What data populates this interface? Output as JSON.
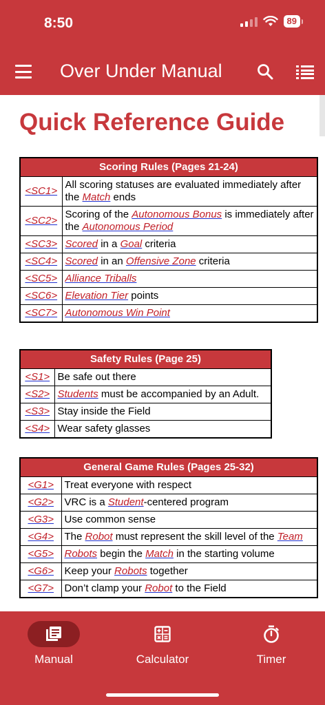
{
  "status": {
    "time": "8:50",
    "battery": "89"
  },
  "appbar": {
    "title": "Over Under Manual"
  },
  "page": {
    "title": "Quick Reference Guide"
  },
  "scoring": {
    "header": "Scoring Rules (Pages 21-24)",
    "rows": [
      {
        "code": "<SC1>",
        "parts": [
          {
            "t": "All scoring statuses are evaluated immediately after the "
          },
          {
            "t": "Match",
            "link": true
          },
          {
            "t": " ends"
          }
        ]
      },
      {
        "code": "<SC2>",
        "parts": [
          {
            "t": "Scoring of the "
          },
          {
            "t": "Autonomous Bonus",
            "link": true
          },
          {
            "t": " is immediately after the "
          },
          {
            "t": "Autonomous Period",
            "link": true
          }
        ]
      },
      {
        "code": "<SC3>",
        "parts": [
          {
            "t": "Scored",
            "link": true
          },
          {
            "t": " in a "
          },
          {
            "t": "Goal",
            "link": true
          },
          {
            "t": " criteria"
          }
        ]
      },
      {
        "code": "<SC4>",
        "parts": [
          {
            "t": "Scored",
            "link": true
          },
          {
            "t": " in an "
          },
          {
            "t": "Offensive Zone",
            "link": true
          },
          {
            "t": " criteria"
          }
        ]
      },
      {
        "code": "<SC5>",
        "parts": [
          {
            "t": "Alliance Triballs",
            "link": true
          }
        ]
      },
      {
        "code": "<SC6>",
        "parts": [
          {
            "t": "Elevation Tier",
            "link": true
          },
          {
            "t": " points"
          }
        ]
      },
      {
        "code": "<SC7>",
        "parts": [
          {
            "t": "Autonomous Win Point",
            "link": true
          }
        ]
      }
    ]
  },
  "safety": {
    "header": "Safety Rules (Page 25)",
    "rows": [
      {
        "code": "<S1>",
        "parts": [
          {
            "t": "Be safe out there"
          }
        ]
      },
      {
        "code": "<S2>",
        "parts": [
          {
            "t": "Students",
            "link": true
          },
          {
            "t": " must be accompanied by an Adult."
          }
        ]
      },
      {
        "code": "<S3>",
        "parts": [
          {
            "t": "Stay inside the Field"
          }
        ]
      },
      {
        "code": "<S4>",
        "parts": [
          {
            "t": "Wear safety glasses"
          }
        ]
      }
    ]
  },
  "general": {
    "header": "General Game Rules (Pages 25-32)",
    "rows": [
      {
        "code": "<G1>",
        "parts": [
          {
            "t": "Treat everyone with respect"
          }
        ]
      },
      {
        "code": "<G2>",
        "parts": [
          {
            "t": "VRC is a "
          },
          {
            "t": "Student",
            "link": true
          },
          {
            "t": "-centered program"
          }
        ]
      },
      {
        "code": "<G3>",
        "parts": [
          {
            "t": "Use common sense"
          }
        ]
      },
      {
        "code": "<G4>",
        "parts": [
          {
            "t": "The "
          },
          {
            "t": "Robot",
            "link": true
          },
          {
            "t": " must represent the skill level of the "
          },
          {
            "t": "Team",
            "link": true
          }
        ]
      },
      {
        "code": "<G5>",
        "parts": [
          {
            "t": "Robots",
            "link": true
          },
          {
            "t": " begin the "
          },
          {
            "t": "Match",
            "link": true
          },
          {
            "t": " in the starting volume"
          }
        ]
      },
      {
        "code": "<G6>",
        "parts": [
          {
            "t": "Keep your "
          },
          {
            "t": "Robots",
            "link": true
          },
          {
            "t": " together"
          }
        ]
      },
      {
        "code": "<G7>",
        "parts": [
          {
            "t": "Don’t clamp your "
          },
          {
            "t": "Robot",
            "link": true
          },
          {
            "t": " to the Field"
          }
        ]
      }
    ]
  },
  "nav": {
    "manual": "Manual",
    "calculator": "Calculator",
    "timer": "Timer"
  },
  "icons": {
    "menu": "hamburger-menu-icon",
    "search": "search-icon",
    "list": "list-icon",
    "manual": "book-icon",
    "calculator": "calculator-icon",
    "timer": "stopwatch-icon"
  },
  "colors": {
    "brand": "#c7383c",
    "nav_active": "#8c1f22",
    "link": "#c0202a"
  }
}
